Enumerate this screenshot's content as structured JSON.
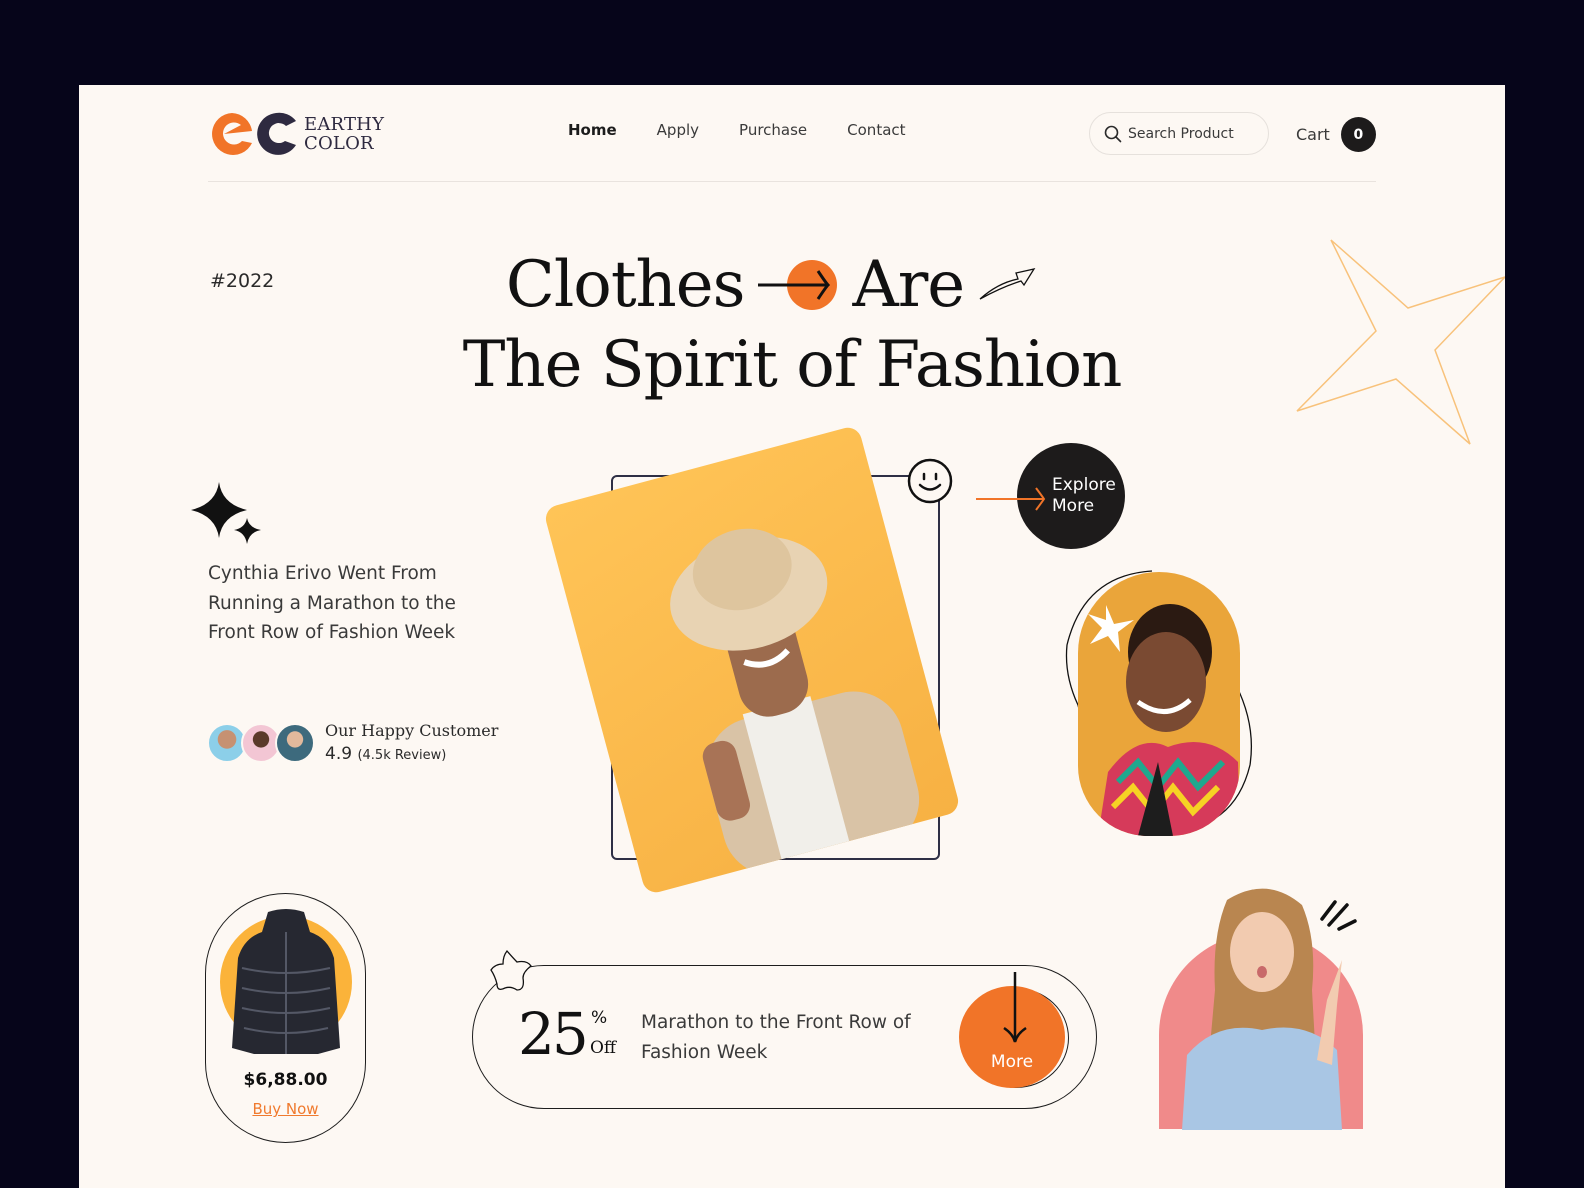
{
  "brand": {
    "name_line1": "EARTHY",
    "name_line2": "COLOR",
    "primary_color": "#f17428",
    "dark_color": "#2e2a40",
    "background": "#fdf8f3"
  },
  "nav": {
    "items": [
      {
        "label": "Home",
        "active": true
      },
      {
        "label": "Apply",
        "active": false
      },
      {
        "label": "Purchase",
        "active": false
      },
      {
        "label": "Contact",
        "active": false
      }
    ]
  },
  "search": {
    "placeholder": "Search Product",
    "value": "",
    "icon": "search-icon"
  },
  "cart": {
    "label": "Cart",
    "count": "0"
  },
  "hero": {
    "tag": "#2022",
    "headline_line1_a": "Clothes",
    "headline_line1_b": "Are",
    "headline_line2": "The Spirit of Fashion"
  },
  "story": {
    "text": "Cynthia Erivo Went From Running a Marathon to the Front Row of Fashion Week"
  },
  "customers": {
    "title": "Our Happy Customer",
    "rating": "4.9",
    "reviews": "(4.5k Review)"
  },
  "explore": {
    "line1": "Explore",
    "line2": "More"
  },
  "product": {
    "price": "$6,88.00",
    "cta": "Buy Now"
  },
  "promo": {
    "amount": "25",
    "percent": "%",
    "off": "Off",
    "text": "Marathon to the Front Row of Fashion Week",
    "cta": "More"
  }
}
